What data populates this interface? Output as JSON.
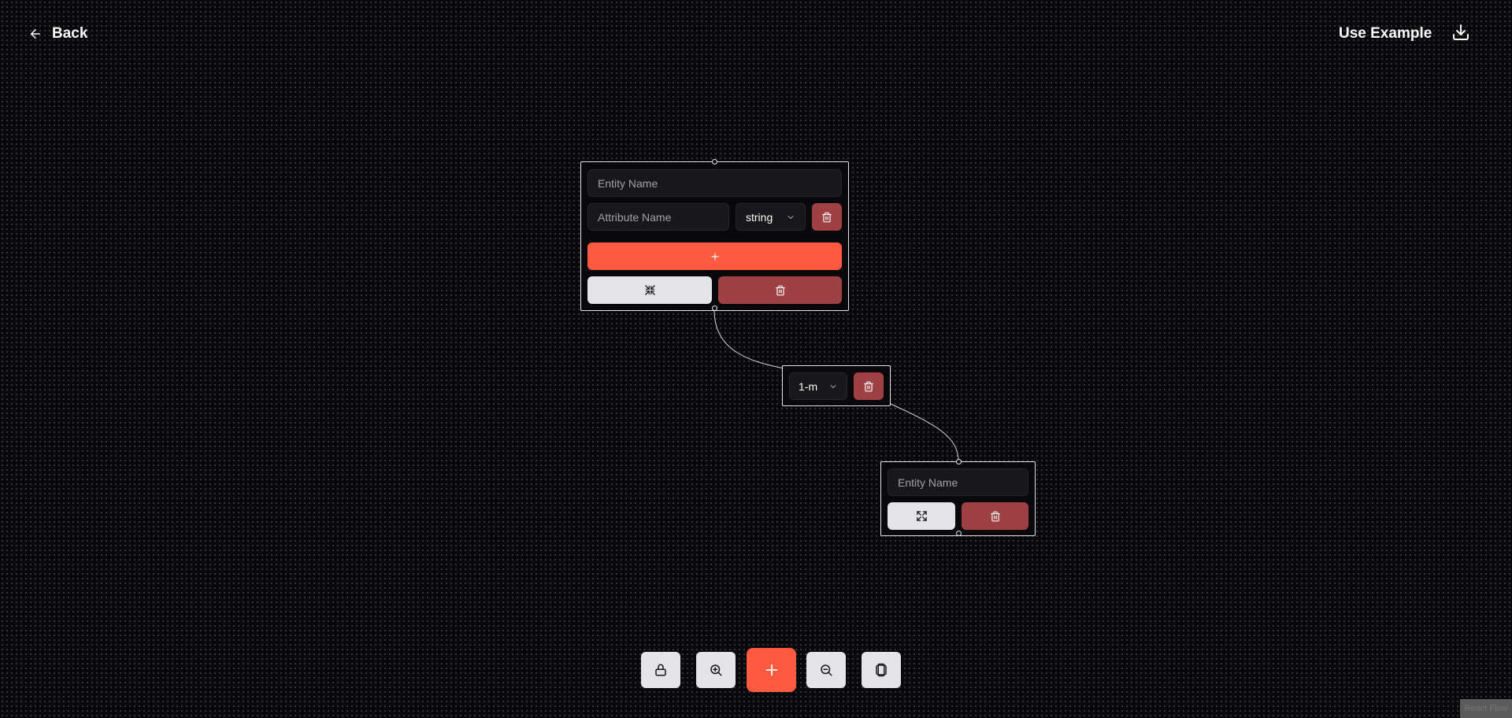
{
  "header": {
    "back_label": "Back",
    "use_example_label": "Use Example",
    "download_icon": "download-icon"
  },
  "nodes": {
    "entity_1": {
      "name_placeholder": "Entity Name",
      "attributes": [
        {
          "name_placeholder": "Attribute Name",
          "type_value": "string"
        }
      ],
      "add_attribute_icon": "plus-icon",
      "collapse_icon": "minimize-icon",
      "delete_icon": "trash-icon"
    },
    "relation": {
      "type_value": "1-m",
      "delete_icon": "trash-icon"
    },
    "entity_2": {
      "name_placeholder": "Entity Name",
      "expand_icon": "maximize-icon",
      "delete_icon": "trash-icon"
    }
  },
  "toolbar": {
    "buttons": [
      "lock-icon",
      "zoom-in-icon",
      "plus-icon",
      "zoom-out-icon",
      "fit-view-icon"
    ]
  },
  "attribution": "React Flow",
  "colors": {
    "background": "#09090b",
    "accent": "#fe5a3f",
    "danger": "#9f4144",
    "light_button": "#e4e4e7",
    "border": "#e4e4e7"
  }
}
